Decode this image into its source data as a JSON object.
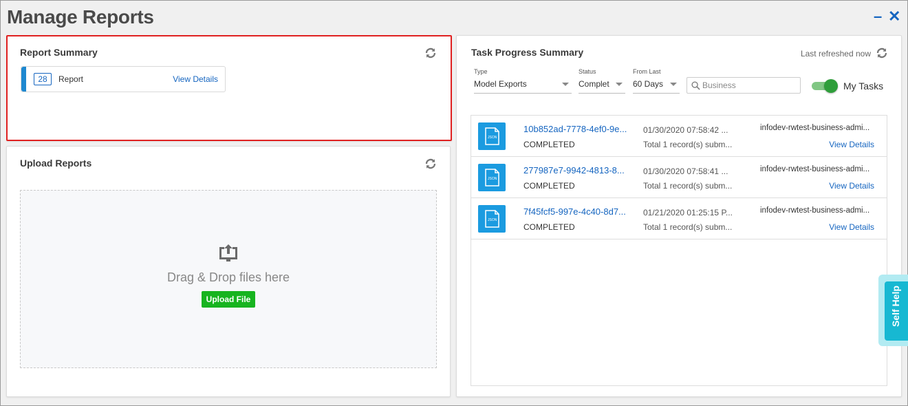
{
  "page": {
    "title": "Manage Reports",
    "minimize_glyph": "–",
    "close_glyph": "✕"
  },
  "report_summary": {
    "title": "Report Summary",
    "count": "28",
    "label": "Report",
    "link": "View Details"
  },
  "upload": {
    "title": "Upload Reports",
    "drop_text": "Drag & Drop files here",
    "button": "Upload File"
  },
  "task_progress": {
    "title": "Task Progress Summary",
    "last_refreshed": "Last refreshed now",
    "filters": {
      "type_label": "Type",
      "type_value": "Model Exports",
      "status_label": "Status",
      "status_value": "Complet",
      "from_last_label": "From Last",
      "from_last_value": "60 Days",
      "search_placeholder": "Business",
      "my_tasks_label": "My Tasks",
      "my_tasks_on": true
    },
    "tasks": [
      {
        "id": "10b852ad-7778-4ef0-9e...",
        "status": "COMPLETED",
        "date": "01/30/2020 07:58:42 ...",
        "records": "Total 1 record(s) subm...",
        "user": "infodev-rwtest-business-admi...",
        "link": "View Details"
      },
      {
        "id": "277987e7-9942-4813-8...",
        "status": "COMPLETED",
        "date": "01/30/2020 07:58:41 ...",
        "records": "Total 1 record(s) subm...",
        "user": "infodev-rwtest-business-admi...",
        "link": "View Details"
      },
      {
        "id": "7f45fcf5-997e-4c40-8d7...",
        "status": "COMPLETED",
        "date": "01/21/2020 01:25:15 P...",
        "records": "Total 1 record(s) subm...",
        "user": "infodev-rwtest-business-admi...",
        "link": "View Details"
      }
    ],
    "json_icon_text": "JSON"
  },
  "self_help": {
    "label": "Self Help"
  },
  "colors": {
    "accent_blue": "#1565c0",
    "report_bar": "#1e88d0",
    "upload_green": "#17b41f",
    "json_icon": "#1b9be0",
    "highlight_border": "#e02020",
    "toggle_on": "#2e9e3a",
    "self_help": "#17b8d2"
  },
  "icons": {
    "refresh": "refresh-icon",
    "upload": "upload-monitor-icon",
    "search": "search-icon",
    "file": "json-file-icon"
  }
}
